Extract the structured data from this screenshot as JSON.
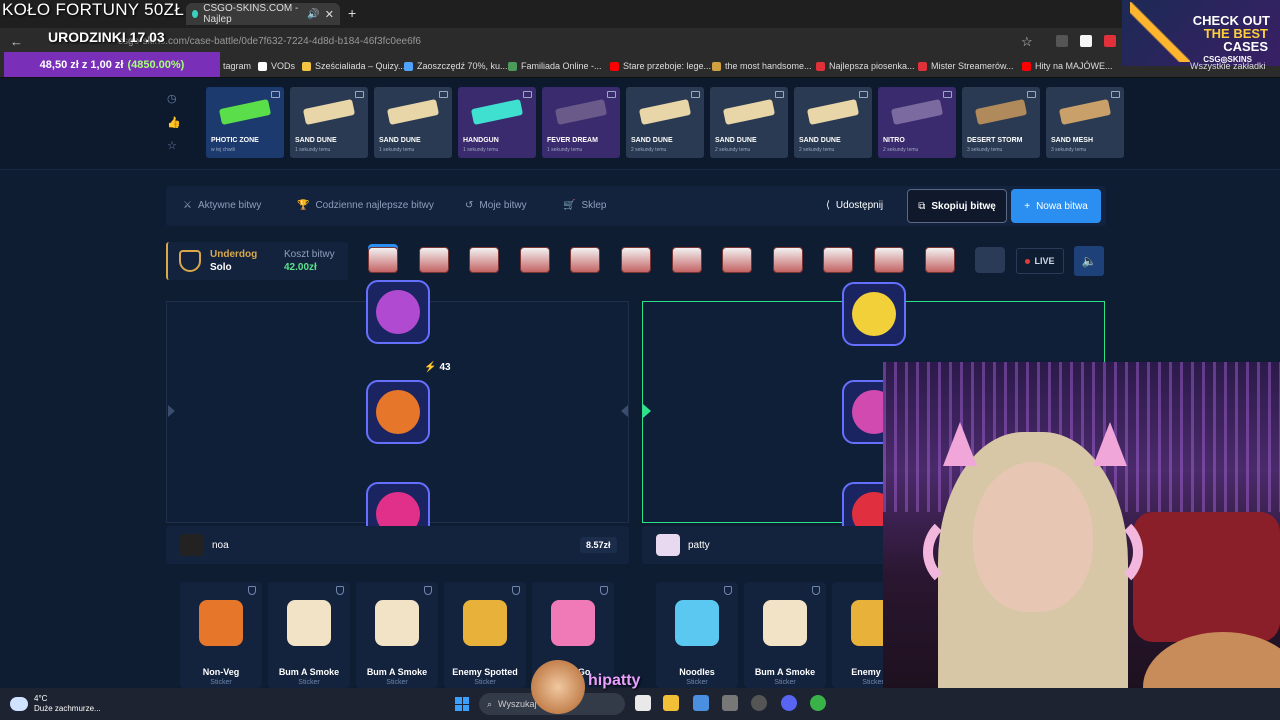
{
  "overlay": {
    "title": "KOŁO FORTUNY 50ZŁ",
    "subtitle": "URODZINKI 17.03",
    "balance": "48,50 zł z 1,00 zł",
    "balance_pct": "(4850.00%)",
    "streamer_handle": "hipatty"
  },
  "browser": {
    "tab_title": "CSGO-SKINS.COM - Najlep",
    "url": "csgo-skins.com/case-battle/0de7f632-7224-4d8d-b184-46f3fc0ee6f6",
    "bookmarks": [
      {
        "label": "tagram",
        "color": "#c13584"
      },
      {
        "label": "VODs",
        "color": "#ffffff"
      },
      {
        "label": "Sześcialiada – Quizy...",
        "color": "#f5c542"
      },
      {
        "label": "Zaoszczędź 70%, ku...",
        "color": "#4fa3ff"
      },
      {
        "label": "Familiada Online -...",
        "color": "#4c9a5a"
      },
      {
        "label": "Stare przeboje: lege...",
        "color": "#ff0000"
      },
      {
        "label": "the most handsome...",
        "color": "#d0a040"
      },
      {
        "label": "Najlepsza piosenka...",
        "color": "#e0303a"
      },
      {
        "label": "Mister Streamerów...",
        "color": "#e0303a"
      },
      {
        "label": "Hity na MAJÓWE...",
        "color": "#ff0000"
      }
    ],
    "bookmarks_right": "Wszystkie zakładki"
  },
  "ad": {
    "line1": "CHECK OUT",
    "line2": "THE BEST",
    "line3": "CASES",
    "brand": "CSG◎SKINS"
  },
  "feed": [
    {
      "name": "PHOTIC ZONE",
      "time": "w tej chwili",
      "bg": "#1d3a6e",
      "gun": "#5adf4a"
    },
    {
      "name": "SAND DUNE",
      "time": "1 sekundy temu",
      "bg": "#2a3a52",
      "gun": "#e8d6a8"
    },
    {
      "name": "SAND DUNE",
      "time": "1 sekundy temu",
      "bg": "#2a3a52",
      "gun": "#e8d6a8"
    },
    {
      "name": "HANDGUN",
      "time": "1 sekundy temu",
      "bg": "#3a2a6e",
      "gun": "#3fe0d0"
    },
    {
      "name": "FEVER DREAM",
      "time": "1 sekundy temu",
      "bg": "#3a2a6e",
      "gun": "#6a5a8a"
    },
    {
      "name": "SAND DUNE",
      "time": "2 sekundy temu",
      "bg": "#2a3a52",
      "gun": "#e8d6a8"
    },
    {
      "name": "SAND DUNE",
      "time": "2 sekundy temu",
      "bg": "#2a3a52",
      "gun": "#e8d6a8"
    },
    {
      "name": "SAND DUNE",
      "time": "2 sekundy temu",
      "bg": "#2a3a52",
      "gun": "#e8d6a8"
    },
    {
      "name": "NITRO",
      "time": "2 sekundy temu",
      "bg": "#3a2a6e",
      "gun": "#7a6aa0"
    },
    {
      "name": "DESERT STORM",
      "time": "3 sekundy temu",
      "bg": "#2a3a52",
      "gun": "#b08a5a"
    },
    {
      "name": "SAND MESH",
      "time": "3 sekundy temu",
      "bg": "#2a3a52",
      "gun": "#c9a06a"
    }
  ],
  "menu": {
    "active": "Aktywne bitwy",
    "daily": "Codzienne najlepsze bitwy",
    "mine": "Moje bitwy",
    "shop": "Sklep",
    "share": "Udostępnij",
    "copy": "Skopiuj bitwę",
    "new": "Nowa bitwa"
  },
  "battle": {
    "mode": "Underdog",
    "type": "Solo",
    "cost_label": "Koszt bitwy",
    "cost_value": "42.00zł",
    "live": "LIVE",
    "count": "43"
  },
  "players": [
    {
      "name": "noa",
      "value": "8.57zł"
    },
    {
      "name": "patty"
    }
  ],
  "items_left": [
    {
      "name": "Non-Veg",
      "type": "Sticker",
      "color": "#e5762a"
    },
    {
      "name": "Bum A Smoke",
      "type": "Sticker",
      "color": "#f3e3c6"
    },
    {
      "name": "Bum A Smoke",
      "type": "Sticker",
      "color": "#f3e3c6"
    },
    {
      "name": "Enemy Spotted",
      "type": "Sticker",
      "color": "#e8b23a"
    },
    {
      "name": "Take Go",
      "type": "Sticker",
      "color": "#f07ab8"
    }
  ],
  "items_right": [
    {
      "name": "Noodles",
      "type": "Sticker",
      "color": "#5ac8f0"
    },
    {
      "name": "Bum A Smoke",
      "type": "Sticker",
      "color": "#f3e3c6"
    },
    {
      "name": "Enemy Sp",
      "type": "Sticker",
      "color": "#e8b23a"
    }
  ],
  "taskbar": {
    "temp": "4°C",
    "weather": "Duże zachmurze...",
    "search": "Wyszukaj"
  }
}
